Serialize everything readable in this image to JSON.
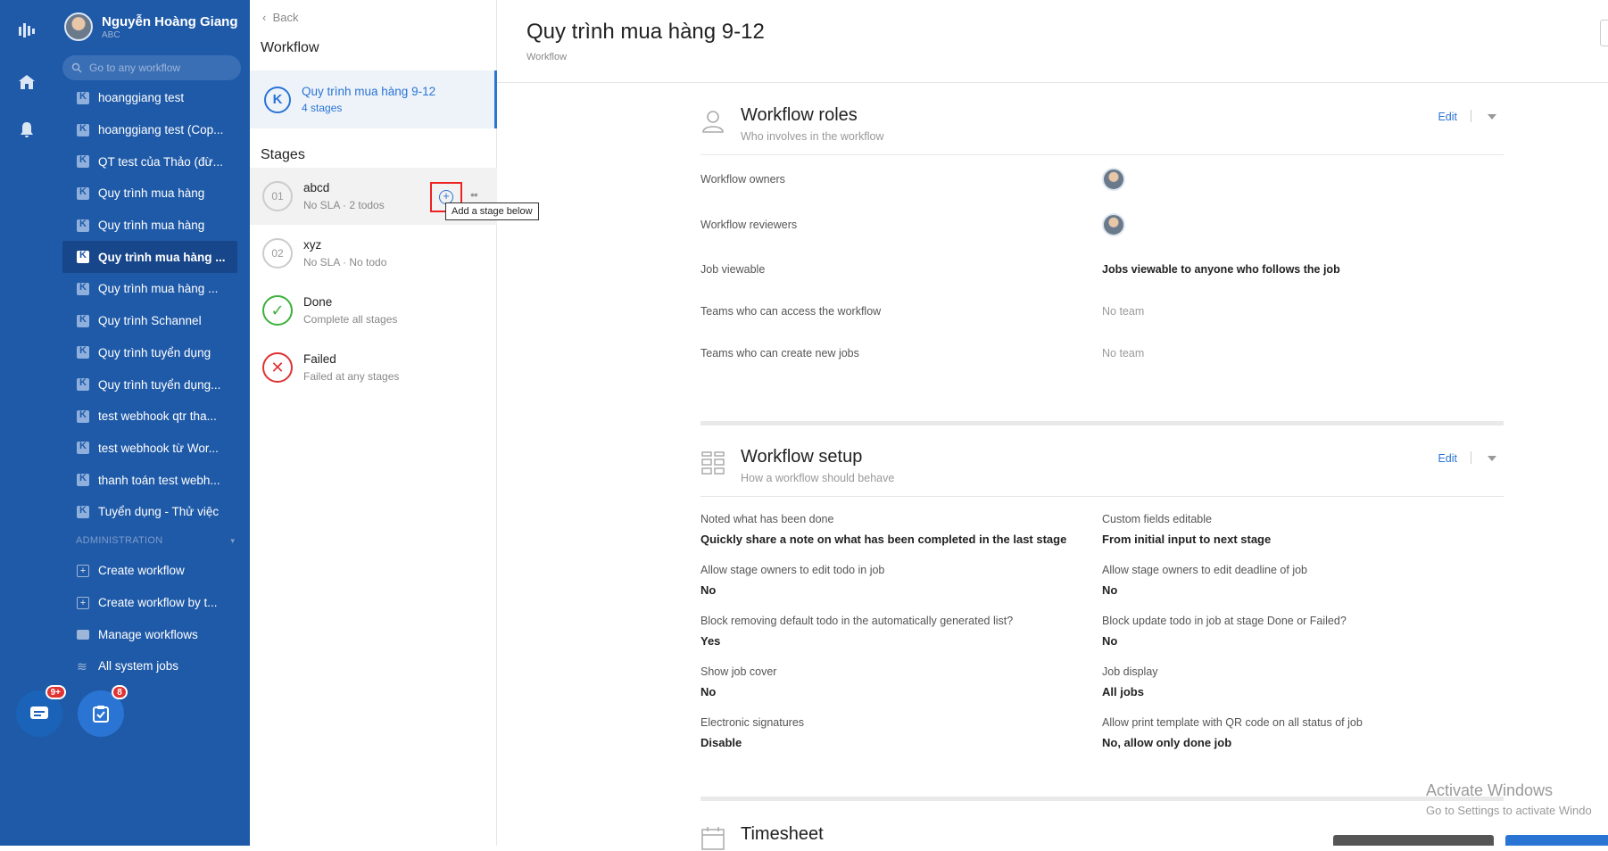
{
  "user": {
    "name": "Nguyễn Hoàng Giang",
    "org": "ABC"
  },
  "search": {
    "placeholder": "Go to any workflow"
  },
  "sidebar": {
    "workflows": [
      {
        "label": "hoanggiang test"
      },
      {
        "label": "hoanggiang test (Cop..."
      },
      {
        "label": "QT test của Thảo (đừ..."
      },
      {
        "label": "Quy trình mua hàng"
      },
      {
        "label": "Quy trình mua hàng"
      },
      {
        "label": "Quy trình mua hàng ..."
      },
      {
        "label": "Quy trình mua hàng ..."
      },
      {
        "label": "Quy trình Schannel"
      },
      {
        "label": "Quy trình tuyển dụng"
      },
      {
        "label": "Quy trình tuyển dụng..."
      },
      {
        "label": "test webhook qtr tha..."
      },
      {
        "label": "test webhook từ Wor..."
      },
      {
        "label": "thanh toán test webh..."
      },
      {
        "label": "Tuyển dụng - Thử việc"
      }
    ],
    "active_index": 5,
    "admin_header": "ADMINISTRATION",
    "admin_items": [
      {
        "label": "Create workflow"
      },
      {
        "label": "Create workflow by t..."
      },
      {
        "label": "Manage workflows"
      },
      {
        "label": "All system jobs"
      }
    ]
  },
  "fabs": {
    "chat_badge": "9+",
    "tasks_badge": "8"
  },
  "middle": {
    "back_label": "Back",
    "workflow_heading": "Workflow",
    "current_workflow": {
      "name": "Quy trình mua hàng 9-12",
      "stages": "4 stages"
    },
    "stages_heading": "Stages",
    "stages": [
      {
        "num": "01",
        "name": "abcd",
        "desc": "No SLA · 2 todos",
        "kind": "normal"
      },
      {
        "num": "02",
        "name": "xyz",
        "desc": "No SLA · No todo",
        "kind": "normal"
      },
      {
        "num": "✓",
        "name": "Done",
        "desc": "Complete all stages",
        "kind": "done"
      },
      {
        "num": "✕",
        "name": "Failed",
        "desc": "Failed at any stages",
        "kind": "failed"
      }
    ],
    "tooltip": "Add a stage below"
  },
  "page": {
    "title": "Quy trình mua hàng 9-12",
    "subtitle": "Workflow"
  },
  "roles": {
    "title": "Workflow roles",
    "subtitle": "Who involves in the workflow",
    "edit_label": "Edit",
    "rows": [
      {
        "label": "Workflow owners",
        "value": ""
      },
      {
        "label": "Workflow reviewers",
        "value": ""
      },
      {
        "label": "Job viewable",
        "value": "Jobs viewable to anyone who follows the job"
      },
      {
        "label": "Teams who can access the workflow",
        "value": "No team"
      },
      {
        "label": "Teams who can create new jobs",
        "value": "No team"
      }
    ]
  },
  "setup": {
    "title": "Workflow setup",
    "subtitle": "How a workflow should behave",
    "edit_label": "Edit",
    "items": [
      {
        "label": "Noted what has been done",
        "value": "Quickly share a note on what has been completed in the last stage"
      },
      {
        "label": "Custom fields editable",
        "value": "From initial input to next stage"
      },
      {
        "label": "Allow stage owners to edit todo in job",
        "value": "No"
      },
      {
        "label": "Allow stage owners to edit deadline of job",
        "value": "No"
      },
      {
        "label": "Block removing default todo in the automatically generated list?",
        "value": "Yes"
      },
      {
        "label": "Block update todo in job at stage Done or Failed?",
        "value": "No"
      },
      {
        "label": "Show job cover",
        "value": "No"
      },
      {
        "label": "Job display",
        "value": "All jobs"
      },
      {
        "label": "Electronic signatures",
        "value": "Disable"
      },
      {
        "label": "Allow print template with QR code on all status of job",
        "value": "No, allow only done job"
      }
    ]
  },
  "timesheet": {
    "title": "Timesheet"
  },
  "watermark": {
    "line1": "Activate Windows",
    "line2": "Go to Settings to activate Windo"
  },
  "colors": {
    "sidebar": "#1f5aa8",
    "accent": "#2a74d4",
    "highlight_box": "#e22222"
  }
}
